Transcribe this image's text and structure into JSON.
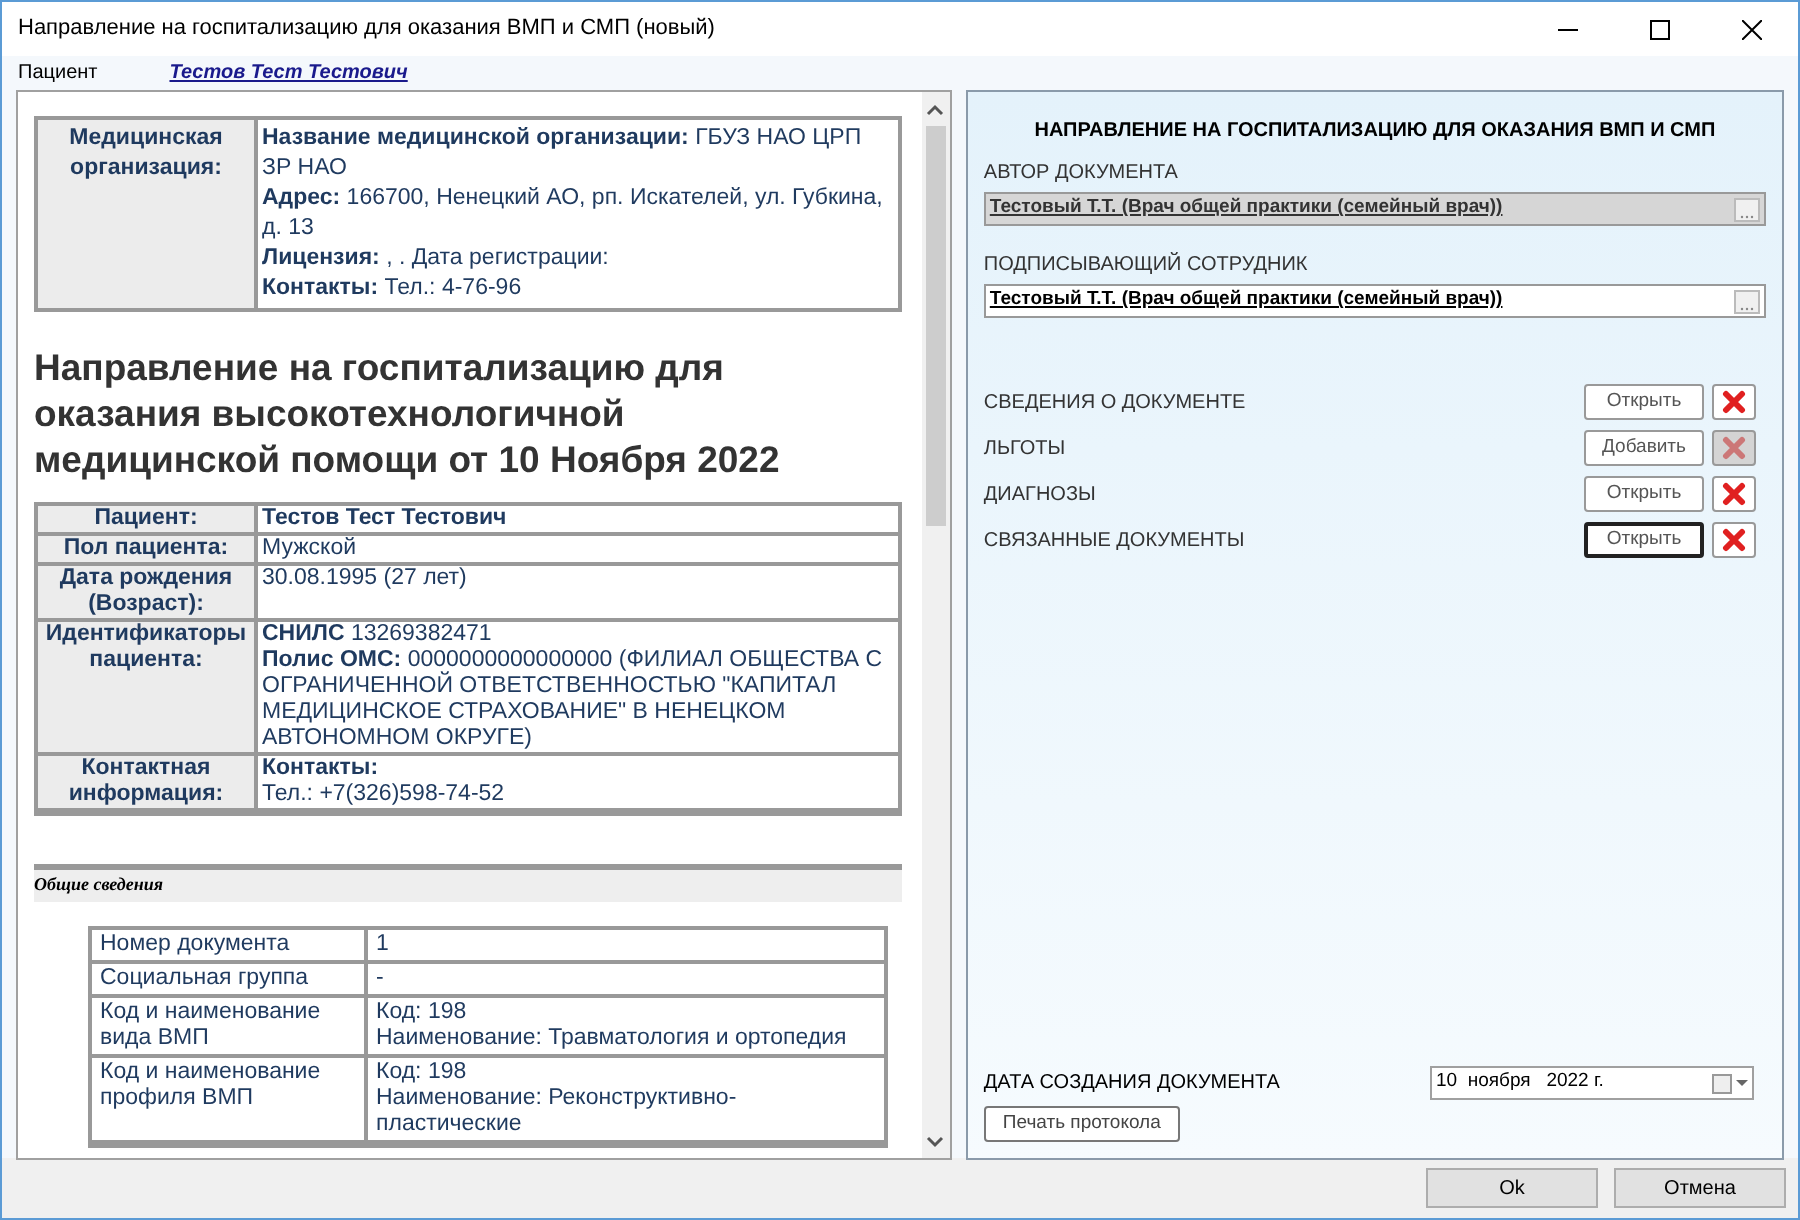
{
  "window": {
    "title": "Направление на госпитализацию для оказания ВМП и СМП (новый)"
  },
  "patient_bar": {
    "label": "Пациент",
    "name": "Тестов Тест Тестович"
  },
  "document": {
    "org_table": [
      {
        "label": "Медицинская организация:",
        "lines": [
          "**Название медицинской организации:** ГБУЗ НАО ЦРП ЗР НАО",
          "**Адрес:** 166700, Ненецкий АО, рп. Искателей, ул. Губкина, д. 13",
          "**Лицензия:** , . Дата регистрации:",
          "**Контакты:** Тел.: 4-76-96"
        ]
      }
    ],
    "heading": "Направление на госпитализацию для оказания высокотехнологичной медицинской помощи от 10 Ноября 2022",
    "patient_table": [
      {
        "label": "Пациент:",
        "lines": [
          "**Тестов Тест Тестович**"
        ]
      },
      {
        "label": "Пол пациента:",
        "lines": [
          "Мужской"
        ]
      },
      {
        "label": "Дата рождения (Возраст):",
        "lines": [
          "30.08.1995 (27 лет)"
        ]
      },
      {
        "label": "Идентификаторы пациента:",
        "lines": [
          "**СНИЛС** 13269382471",
          "**Полис ОМС:** 0000000000000000 (ФИЛИАЛ ОБЩЕСТВА С ОГРАНИЧЕННОЙ ОТВЕТСТВЕННОСТЬЮ \"КАПИТАЛ МЕДИЦИНСКОЕ СТРАХОВАНИЕ\" В НЕНЕЦКОМ АВТОНОМНОМ ОКРУГЕ)"
        ]
      },
      {
        "label": "Контактная информация:",
        "lines": [
          "**Контакты:**",
          "Тел.: +7(326)598-74-52"
        ]
      }
    ],
    "section_title": "Общие сведения",
    "general_table": [
      {
        "label": "Номер документа",
        "lines": [
          "1"
        ]
      },
      {
        "label": "Социальная группа",
        "lines": [
          "-"
        ]
      },
      {
        "label": "Код и наименование вида ВМП",
        "lines": [
          "Код: 198",
          "Наименование: Травматология и ортопедия"
        ]
      },
      {
        "label": "Код и наименование профиля ВМП",
        "lines": [
          "Код: 198",
          "Наименование: Реконструктивно-пластические"
        ]
      }
    ]
  },
  "form": {
    "title": "НАПРАВЛЕНИЕ НА ГОСПИТАЛИЗАЦИЮ ДЛЯ ОКАЗАНИЯ ВМП И СМП",
    "fields": [
      {
        "label": "АВТОР ДОКУМЕНТА",
        "value": "Тестовый Т.Т. (Врач общей практики (семейный врач))",
        "disabled": true
      },
      {
        "label": "ПОДПИСЫВАЮЩИЙ СОТРУДНИК",
        "value": "Тестовый Т.Т. (Врач общей практики (семейный врач))",
        "disabled": false
      }
    ],
    "sections": [
      {
        "label": "СВЕДЕНИЯ О ДОКУМЕНТЕ",
        "action": "Открыть",
        "focused": false,
        "delete_disabled": false
      },
      {
        "label": "ЛЬГОТЫ",
        "action": "Добавить",
        "focused": false,
        "delete_disabled": true
      },
      {
        "label": "ДИАГНОЗЫ",
        "action": "Открыть",
        "focused": false,
        "delete_disabled": false
      },
      {
        "label": "СВЯЗАННЫЕ ДОКУМЕНТЫ",
        "action": "Открыть",
        "focused": true,
        "delete_disabled": false
      }
    ],
    "date_label": "ДАТА СОЗДАНИЯ ДОКУМЕНТА",
    "date_value": "10  ноября   2022 г.",
    "print_button": "Печать протокола"
  },
  "buttons": [
    "Ok",
    "Отмена"
  ]
}
